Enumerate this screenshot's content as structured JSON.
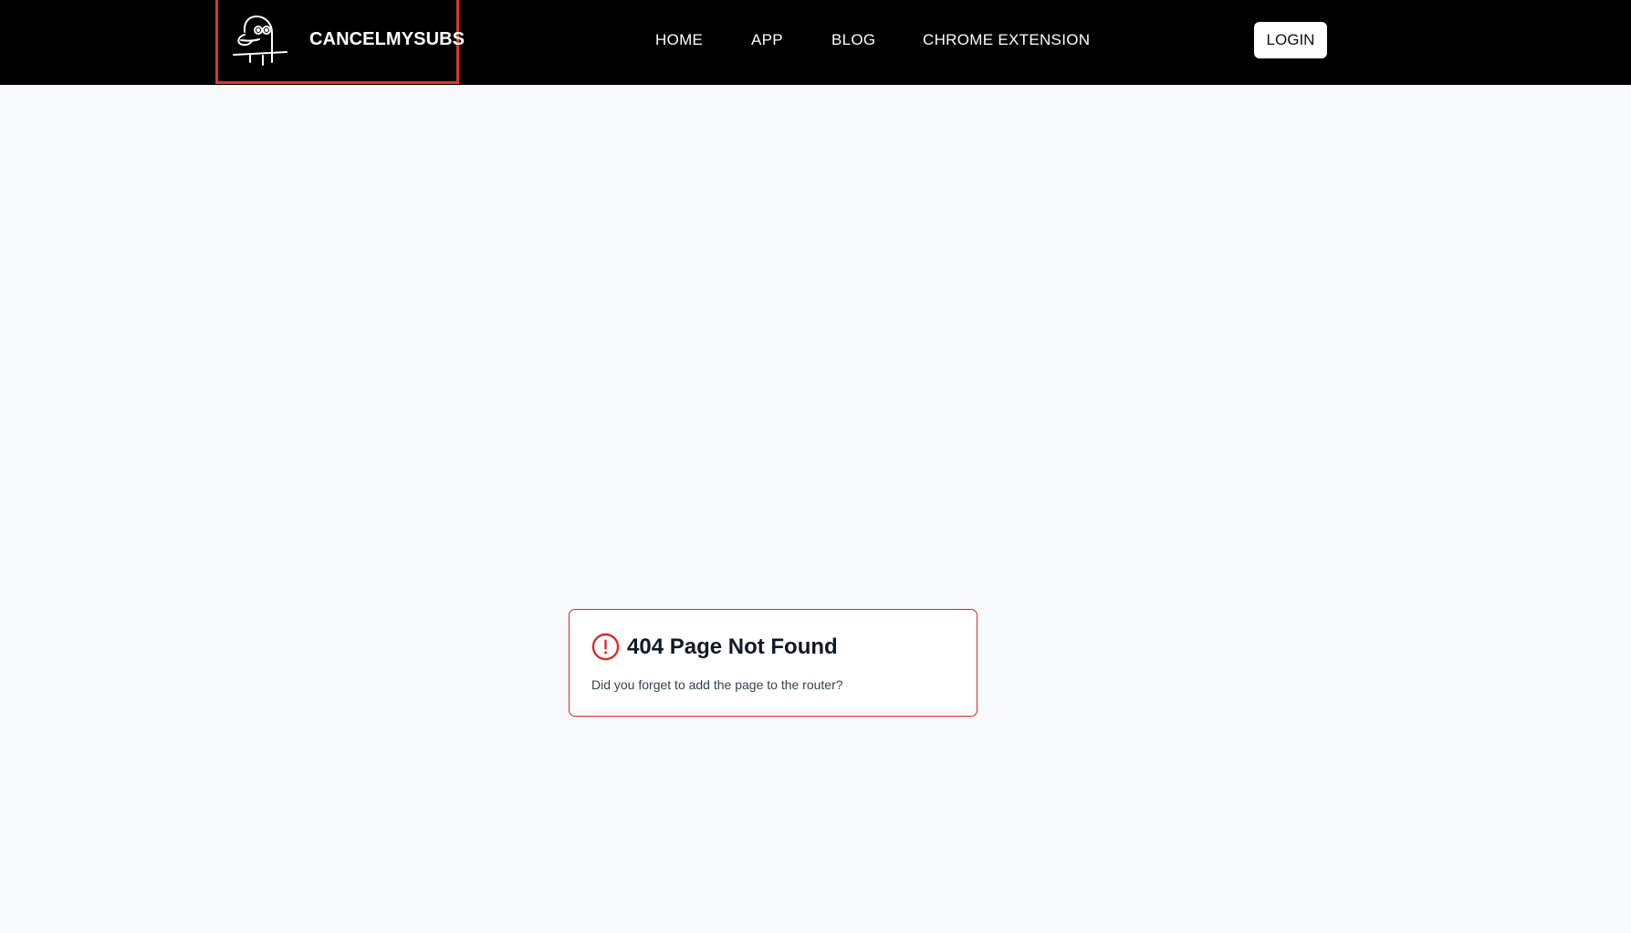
{
  "header": {
    "brand": {
      "name": "CANCELMYSUBS",
      "logo_icon": "cartoon-face-logo-icon"
    },
    "nav": [
      {
        "label": "HOME"
      },
      {
        "label": "APP"
      },
      {
        "label": "BLOG"
      },
      {
        "label": "CHROME EXTENSION"
      }
    ],
    "login_label": "LOGIN"
  },
  "error": {
    "icon": "exclamation-circle-icon",
    "title": "404 Page Not Found",
    "description": "Did you forget to add the page to the router?"
  },
  "colors": {
    "header_bg": "#000000",
    "page_bg": "#f8f9fb",
    "highlight": "#e0342c",
    "error": "#dc2626"
  }
}
